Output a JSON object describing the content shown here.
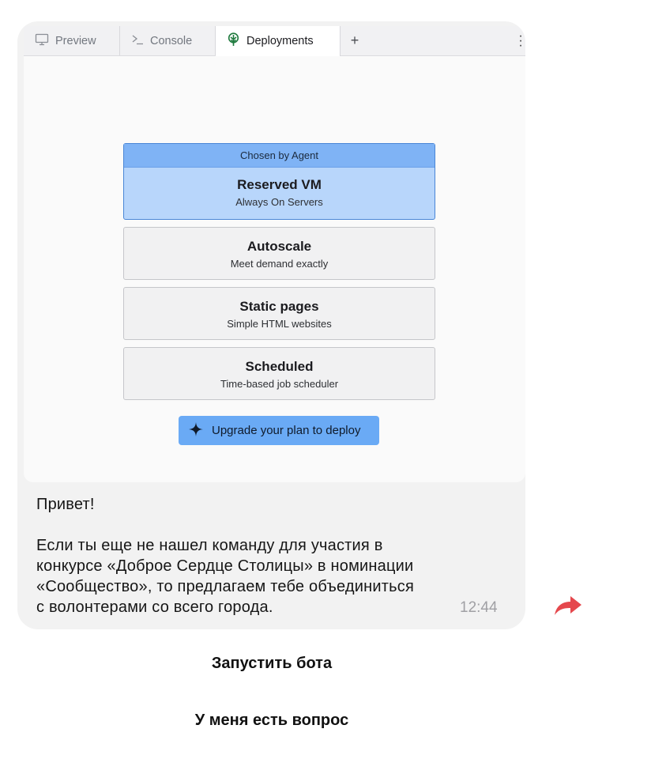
{
  "tabs": {
    "preview": "Preview",
    "console": "Console",
    "deployments": "Deployments",
    "add": "+"
  },
  "deploy": {
    "chosen_label": "Chosen by Agent",
    "options": [
      {
        "title": "Reserved VM",
        "subtitle": "Always On Servers",
        "chosen": true
      },
      {
        "title": "Autoscale",
        "subtitle": "Meet demand exactly",
        "chosen": false
      },
      {
        "title": "Static pages",
        "subtitle": "Simple HTML websites",
        "chosen": false
      },
      {
        "title": "Scheduled",
        "subtitle": "Time-based job scheduler",
        "chosen": false
      }
    ],
    "upgrade_label": "Upgrade your plan to deploy"
  },
  "message": {
    "greeting": "Привет!",
    "line1": "Если ты еще не нашел команду для участия в",
    "line2": "конкурсе «Доброе Сердце Столицы» в номинации",
    "line3": "«Сообщество», то предлагаем тебе объединиться",
    "line4": "с волонтерами со всего города.",
    "time": "12:44"
  },
  "bot_buttons": {
    "start": "Запустить бота",
    "question": "У меня есть вопрос"
  },
  "colors": {
    "chosen_header": "#7fb3f5",
    "chosen_body": "#b8d6fb",
    "upgrade_button": "#6aaaf5",
    "forward_arrow": "#e5484d"
  },
  "icons": {
    "preview": "monitor-icon",
    "console": "terminal-icon",
    "deployments": "deploy-tree-icon",
    "upgrade": "sparkle-icon",
    "forward": "forward-arrow-icon"
  }
}
